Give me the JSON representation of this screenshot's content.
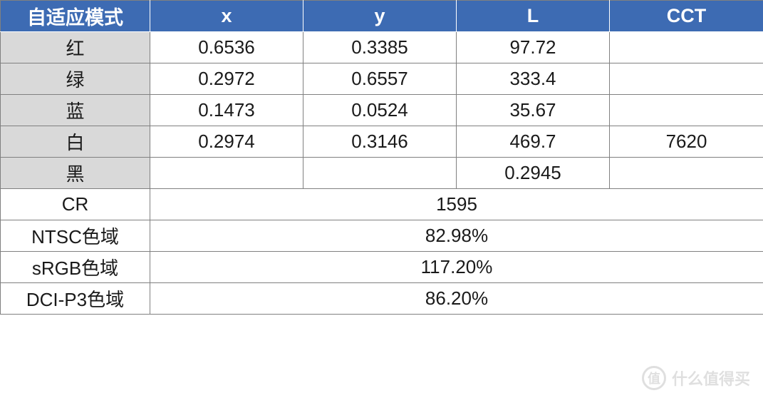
{
  "headers": {
    "mode": "自适应模式",
    "x": "x",
    "y": "y",
    "L": "L",
    "cct": "CCT"
  },
  "rows": {
    "red": {
      "label": "红",
      "x": "0.6536",
      "y": "0.3385",
      "L": "97.72",
      "cct": ""
    },
    "green": {
      "label": "绿",
      "x": "0.2972",
      "y": "0.6557",
      "L": "333.4",
      "cct": ""
    },
    "blue": {
      "label": "蓝",
      "x": "0.1473",
      "y": "0.0524",
      "L": "35.67",
      "cct": ""
    },
    "white": {
      "label": "白",
      "x": "0.2974",
      "y": "0.3146",
      "L": "469.7",
      "cct": "7620"
    },
    "black": {
      "label": "黑",
      "x": "",
      "y": "",
      "L": "0.2945",
      "cct": ""
    }
  },
  "summary": {
    "cr": {
      "label": "CR",
      "value": "1595"
    },
    "ntsc": {
      "label": "NTSC色域",
      "value": "82.98%"
    },
    "srgb": {
      "label": "sRGB色域",
      "value": "117.20%"
    },
    "dcip3": {
      "label": "DCI-P3色域",
      "value": "86.20%"
    }
  },
  "watermark": {
    "icon": "值",
    "text": "什么值得买"
  },
  "chart_data": {
    "type": "table",
    "title": "自适应模式",
    "columns": [
      "",
      "x",
      "y",
      "L",
      "CCT"
    ],
    "rows": [
      [
        "红",
        0.6536,
        0.3385,
        97.72,
        null
      ],
      [
        "绿",
        0.2972,
        0.6557,
        333.4,
        null
      ],
      [
        "蓝",
        0.1473,
        0.0524,
        35.67,
        null
      ],
      [
        "白",
        0.2974,
        0.3146,
        469.7,
        7620
      ],
      [
        "黑",
        null,
        null,
        0.2945,
        null
      ]
    ],
    "summary": {
      "CR": 1595,
      "NTSC色域": "82.98%",
      "sRGB色域": "117.20%",
      "DCI-P3色域": "86.20%"
    }
  }
}
